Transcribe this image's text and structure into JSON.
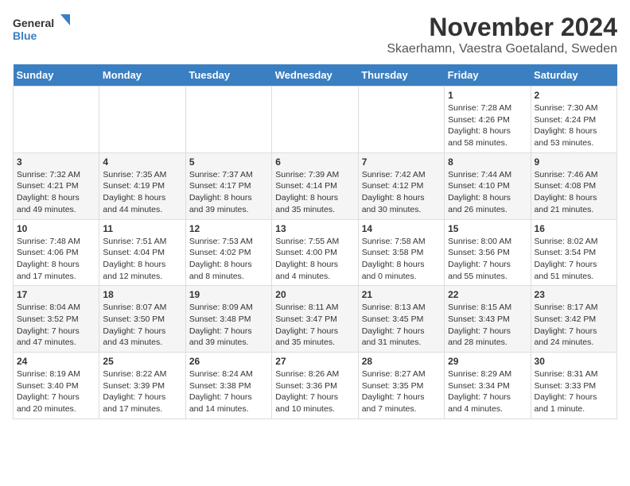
{
  "logo": {
    "text_general": "General",
    "text_blue": "Blue"
  },
  "header": {
    "title": "November 2024",
    "subtitle": "Skaerhamn, Vaestra Goetaland, Sweden"
  },
  "weekdays": [
    "Sunday",
    "Monday",
    "Tuesday",
    "Wednesday",
    "Thursday",
    "Friday",
    "Saturday"
  ],
  "weeks": [
    [
      {
        "day": "",
        "info": ""
      },
      {
        "day": "",
        "info": ""
      },
      {
        "day": "",
        "info": ""
      },
      {
        "day": "",
        "info": ""
      },
      {
        "day": "",
        "info": ""
      },
      {
        "day": "1",
        "info": "Sunrise: 7:28 AM\nSunset: 4:26 PM\nDaylight: 8 hours\nand 58 minutes."
      },
      {
        "day": "2",
        "info": "Sunrise: 7:30 AM\nSunset: 4:24 PM\nDaylight: 8 hours\nand 53 minutes."
      }
    ],
    [
      {
        "day": "3",
        "info": "Sunrise: 7:32 AM\nSunset: 4:21 PM\nDaylight: 8 hours\nand 49 minutes."
      },
      {
        "day": "4",
        "info": "Sunrise: 7:35 AM\nSunset: 4:19 PM\nDaylight: 8 hours\nand 44 minutes."
      },
      {
        "day": "5",
        "info": "Sunrise: 7:37 AM\nSunset: 4:17 PM\nDaylight: 8 hours\nand 39 minutes."
      },
      {
        "day": "6",
        "info": "Sunrise: 7:39 AM\nSunset: 4:14 PM\nDaylight: 8 hours\nand 35 minutes."
      },
      {
        "day": "7",
        "info": "Sunrise: 7:42 AM\nSunset: 4:12 PM\nDaylight: 8 hours\nand 30 minutes."
      },
      {
        "day": "8",
        "info": "Sunrise: 7:44 AM\nSunset: 4:10 PM\nDaylight: 8 hours\nand 26 minutes."
      },
      {
        "day": "9",
        "info": "Sunrise: 7:46 AM\nSunset: 4:08 PM\nDaylight: 8 hours\nand 21 minutes."
      }
    ],
    [
      {
        "day": "10",
        "info": "Sunrise: 7:48 AM\nSunset: 4:06 PM\nDaylight: 8 hours\nand 17 minutes."
      },
      {
        "day": "11",
        "info": "Sunrise: 7:51 AM\nSunset: 4:04 PM\nDaylight: 8 hours\nand 12 minutes."
      },
      {
        "day": "12",
        "info": "Sunrise: 7:53 AM\nSunset: 4:02 PM\nDaylight: 8 hours\nand 8 minutes."
      },
      {
        "day": "13",
        "info": "Sunrise: 7:55 AM\nSunset: 4:00 PM\nDaylight: 8 hours\nand 4 minutes."
      },
      {
        "day": "14",
        "info": "Sunrise: 7:58 AM\nSunset: 3:58 PM\nDaylight: 8 hours\nand 0 minutes."
      },
      {
        "day": "15",
        "info": "Sunrise: 8:00 AM\nSunset: 3:56 PM\nDaylight: 7 hours\nand 55 minutes."
      },
      {
        "day": "16",
        "info": "Sunrise: 8:02 AM\nSunset: 3:54 PM\nDaylight: 7 hours\nand 51 minutes."
      }
    ],
    [
      {
        "day": "17",
        "info": "Sunrise: 8:04 AM\nSunset: 3:52 PM\nDaylight: 7 hours\nand 47 minutes."
      },
      {
        "day": "18",
        "info": "Sunrise: 8:07 AM\nSunset: 3:50 PM\nDaylight: 7 hours\nand 43 minutes."
      },
      {
        "day": "19",
        "info": "Sunrise: 8:09 AM\nSunset: 3:48 PM\nDaylight: 7 hours\nand 39 minutes."
      },
      {
        "day": "20",
        "info": "Sunrise: 8:11 AM\nSunset: 3:47 PM\nDaylight: 7 hours\nand 35 minutes."
      },
      {
        "day": "21",
        "info": "Sunrise: 8:13 AM\nSunset: 3:45 PM\nDaylight: 7 hours\nand 31 minutes."
      },
      {
        "day": "22",
        "info": "Sunrise: 8:15 AM\nSunset: 3:43 PM\nDaylight: 7 hours\nand 28 minutes."
      },
      {
        "day": "23",
        "info": "Sunrise: 8:17 AM\nSunset: 3:42 PM\nDaylight: 7 hours\nand 24 minutes."
      }
    ],
    [
      {
        "day": "24",
        "info": "Sunrise: 8:19 AM\nSunset: 3:40 PM\nDaylight: 7 hours\nand 20 minutes."
      },
      {
        "day": "25",
        "info": "Sunrise: 8:22 AM\nSunset: 3:39 PM\nDaylight: 7 hours\nand 17 minutes."
      },
      {
        "day": "26",
        "info": "Sunrise: 8:24 AM\nSunset: 3:38 PM\nDaylight: 7 hours\nand 14 minutes."
      },
      {
        "day": "27",
        "info": "Sunrise: 8:26 AM\nSunset: 3:36 PM\nDaylight: 7 hours\nand 10 minutes."
      },
      {
        "day": "28",
        "info": "Sunrise: 8:27 AM\nSunset: 3:35 PM\nDaylight: 7 hours\nand 7 minutes."
      },
      {
        "day": "29",
        "info": "Sunrise: 8:29 AM\nSunset: 3:34 PM\nDaylight: 7 hours\nand 4 minutes."
      },
      {
        "day": "30",
        "info": "Sunrise: 8:31 AM\nSunset: 3:33 PM\nDaylight: 7 hours\nand 1 minute."
      }
    ]
  ]
}
